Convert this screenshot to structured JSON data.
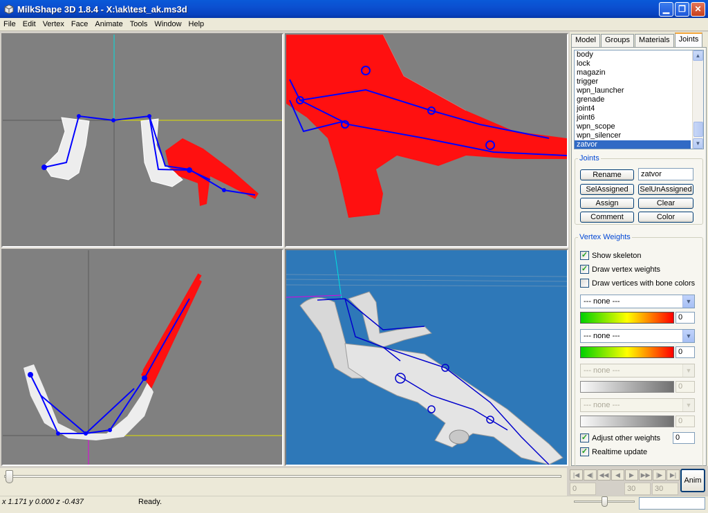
{
  "window": {
    "title": "MilkShape 3D 1.8.4 - X:\\ak\\test_ak.ms3d"
  },
  "menu": [
    "File",
    "Edit",
    "Vertex",
    "Face",
    "Animate",
    "Tools",
    "Window",
    "Help"
  ],
  "tabs": [
    "Model",
    "Groups",
    "Materials",
    "Joints"
  ],
  "active_tab": "Joints",
  "joints_list": [
    "body",
    "lock",
    "magazin",
    "trigger",
    "wpn_launcher",
    "grenade",
    "joint4",
    "joint6",
    "wpn_scope",
    "wpn_silencer",
    "zatvor"
  ],
  "selected_joint": "zatvor",
  "joints_group": {
    "legend": "Joints",
    "rename": "Rename",
    "name_value": "zatvor",
    "sel_assigned": "SelAssigned",
    "sel_unassigned": "SelUnAssigned",
    "assign": "Assign",
    "clear": "Clear",
    "comment": "Comment",
    "color": "Color"
  },
  "vertex_weights": {
    "legend": "Vertex Weights",
    "show_skeleton": "Show skeleton",
    "draw_vertex_weights": "Draw vertex weights",
    "draw_vertices_bone_colors": "Draw vertices with bone colors",
    "combos": [
      "--- none ---",
      "--- none ---",
      "--- none ---",
      "--- none ---"
    ],
    "weights": [
      "0",
      "0",
      "0",
      "0"
    ],
    "adjust_other_weights": "Adjust other weights",
    "adjust_value": "0",
    "realtime_update": "Realtime update"
  },
  "checks": {
    "show_skeleton": true,
    "draw_vertex_weights": true,
    "draw_vertices_bone_colors": false,
    "adjust_other_weights": true,
    "realtime_update": true
  },
  "frames": [
    "0",
    "30",
    "30"
  ],
  "anim_button": "Anim",
  "status": {
    "coords": "x 1.171 y 0.000 z -0.437",
    "message": "Ready."
  },
  "colors": {
    "viewport_bg": "#808080",
    "persp_bg": "#2e78b8",
    "selected_mesh": "#ff0000",
    "skeleton": "#0000ff",
    "title_blue": "#0b4fd0"
  }
}
